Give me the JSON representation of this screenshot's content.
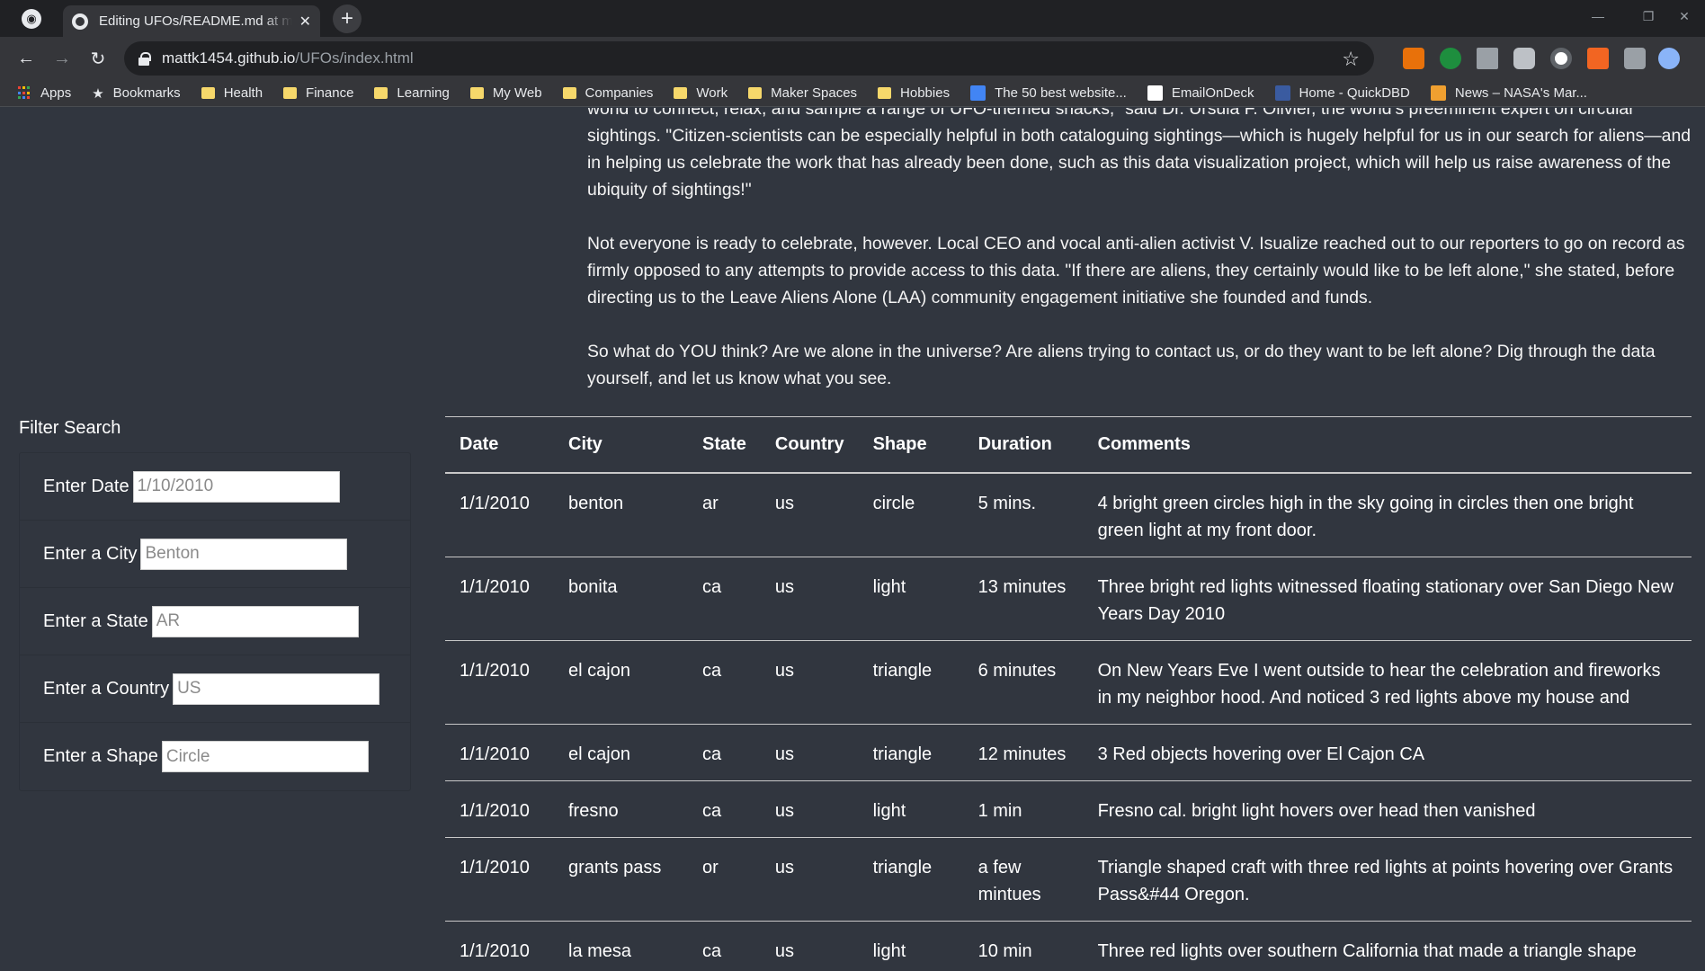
{
  "browser": {
    "tab_title": "Editing UFOs/README.md at master",
    "url_host": "mattk1454.github.io",
    "url_path": "/UFOs/index.html",
    "bookmarks": [
      {
        "label": "Apps",
        "icon": "apps-grid-icon"
      },
      {
        "label": "Bookmarks",
        "icon": "star-icon"
      },
      {
        "label": "Health",
        "icon": "folder-icon"
      },
      {
        "label": "Finance",
        "icon": "folder-icon"
      },
      {
        "label": "Learning",
        "icon": "folder-icon"
      },
      {
        "label": "My Web",
        "icon": "folder-icon"
      },
      {
        "label": "Companies",
        "icon": "folder-icon"
      },
      {
        "label": "Work",
        "icon": "folder-icon"
      },
      {
        "label": "Maker Spaces",
        "icon": "folder-icon"
      },
      {
        "label": "Hobbies",
        "icon": "folder-icon"
      },
      {
        "label": "The 50 best website...",
        "icon": "site-favicon"
      },
      {
        "label": "EmailOnDeck",
        "icon": "site-favicon"
      },
      {
        "label": "Home - QuickDBD",
        "icon": "site-favicon"
      },
      {
        "label": "News – NASA's Mar...",
        "icon": "site-favicon"
      }
    ]
  },
  "article": {
    "paragraphs": [
      "world to connect, relax, and sample a range of UFO-themed snacks,” said Dr. Ursula F. Olivier, the world’s preeminent expert on circular sightings. \"Citizen-scientists can be especially helpful in both cataloguing sightings—which is hugely helpful for us in our search for aliens—and in helping us celebrate the work that has already been done, such as this data visualization project, which will help us raise awareness of the ubiquity of sightings!\"",
      "Not everyone is ready to celebrate, however. Local CEO and vocal anti-alien activist V. Isualize reached out to our reporters to go on record as firmly opposed to any attempts to provide access to this data. \"If there are aliens, they certainly would like to be left alone,\" she stated, before directing us to the Leave Aliens Alone (LAA) community engagement initiative she founded and funds.",
      "So what do YOU think? Are we alone in the universe? Are aliens trying to contact us, or do they want to be left alone? Dig through the data yourself, and let us know what you see."
    ]
  },
  "filter": {
    "title": "Filter Search",
    "fields": [
      {
        "label": "Enter Date",
        "placeholder": "1/10/2010"
      },
      {
        "label": "Enter a City",
        "placeholder": "Benton"
      },
      {
        "label": "Enter a State",
        "placeholder": "AR"
      },
      {
        "label": "Enter a Country",
        "placeholder": "US"
      },
      {
        "label": "Enter a Shape",
        "placeholder": "Circle"
      }
    ]
  },
  "table": {
    "headers": [
      "Date",
      "City",
      "State",
      "Country",
      "Shape",
      "Duration",
      "Comments"
    ],
    "rows": [
      [
        "1/1/2010",
        "benton",
        "ar",
        "us",
        "circle",
        "5 mins.",
        "4 bright green circles high in the sky going in circles then one bright green light at my front door."
      ],
      [
        "1/1/2010",
        "bonita",
        "ca",
        "us",
        "light",
        "13 minutes",
        "Three bright red lights witnessed floating stationary over San Diego New Years Day 2010"
      ],
      [
        "1/1/2010",
        "el cajon",
        "ca",
        "us",
        "triangle",
        "6 minutes",
        "On New Years Eve I went outside to hear the celebration and fireworks in my neighbor hood. And noticed 3 red lights above my house and"
      ],
      [
        "1/1/2010",
        "el cajon",
        "ca",
        "us",
        "triangle",
        "12 minutes",
        "3 Red objects hovering over El Cajon CA"
      ],
      [
        "1/1/2010",
        "fresno",
        "ca",
        "us",
        "light",
        "1 min",
        "Fresno cal. bright light hovers over head then vanished"
      ],
      [
        "1/1/2010",
        "grants pass",
        "or",
        "us",
        "triangle",
        "a few mintues",
        "Triangle shaped craft with three red lights at points hovering over Grants Pass&#44 Oregon."
      ],
      [
        "1/1/2010",
        "la mesa",
        "ca",
        "us",
        "light",
        "10 min",
        "Three red lights over southern California that made a triangle shape"
      ]
    ]
  },
  "colors": {
    "page_bg": "#31363f",
    "chrome_dark": "#202124",
    "chrome_toolbar": "#35363a",
    "text": "#ffffff"
  }
}
